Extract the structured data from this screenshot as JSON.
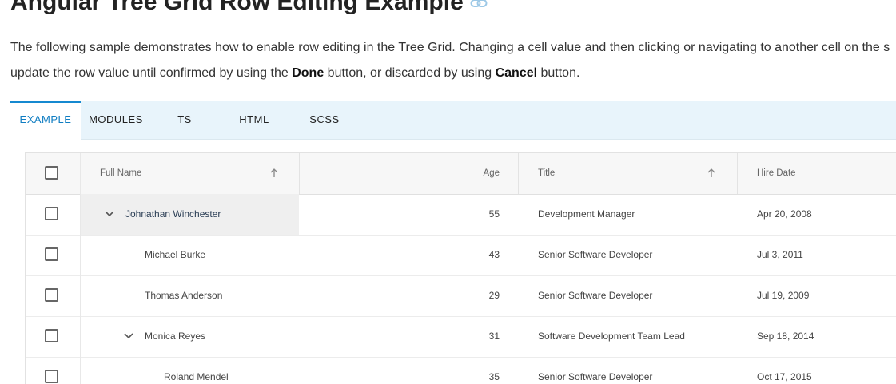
{
  "page": {
    "title": "Angular Tree Grid Row Editing Example",
    "description_part1": "The following sample demonstrates how to enable row editing in the Tree Grid. Changing a cell value and then clicking or navigating to another cell on the s",
    "description_part2_a": "update the row value until confirmed by using the ",
    "description_part2_done": "Done",
    "description_part2_b": " button, or discarded by using ",
    "description_part2_cancel": "Cancel",
    "description_part2_c": " button."
  },
  "tabs": [
    {
      "label": "EXAMPLE",
      "active": true
    },
    {
      "label": "MODULES"
    },
    {
      "label": "TS"
    },
    {
      "label": "HTML"
    },
    {
      "label": "SCSS"
    }
  ],
  "grid": {
    "columns": {
      "full_name": "Full Name",
      "age": "Age",
      "title": "Title",
      "hire_date": "Hire Date"
    },
    "rows": [
      {
        "name": "Johnathan Winchester",
        "age": "55",
        "title": "Development Manager",
        "hire": "Apr 20, 2008",
        "level": 0,
        "expandable": true
      },
      {
        "name": "Michael Burke",
        "age": "43",
        "title": "Senior Software Developer",
        "hire": "Jul 3, 2011",
        "level": 1
      },
      {
        "name": "Thomas Anderson",
        "age": "29",
        "title": "Senior Software Developer",
        "hire": "Jul 19, 2009",
        "level": 1
      },
      {
        "name": "Monica Reyes",
        "age": "31",
        "title": "Software Development Team Lead",
        "hire": "Sep 18, 2014",
        "level": 1,
        "expandable": true
      },
      {
        "name": "Roland Mendel",
        "age": "35",
        "title": "Senior Software Developer",
        "hire": "Oct 17, 2015",
        "level": 2
      }
    ]
  },
  "colors": {
    "accent": "#1589d0",
    "tab_bar": "#e8f4fb"
  }
}
